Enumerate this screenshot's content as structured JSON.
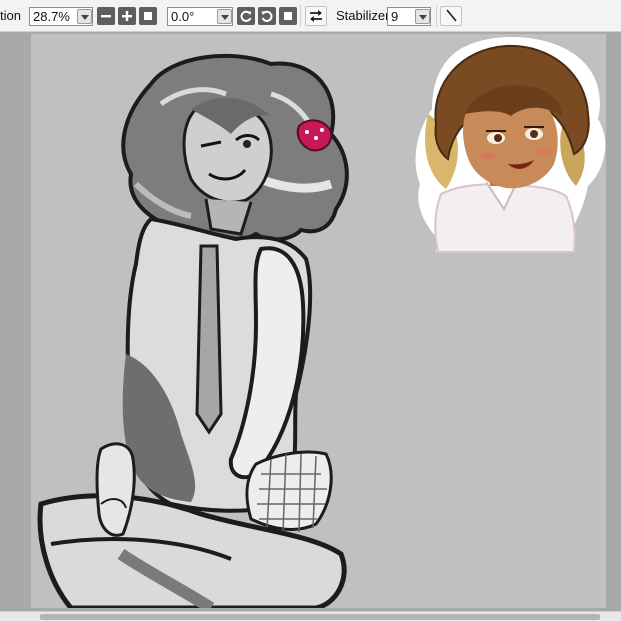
{
  "toolbar": {
    "rotation_label_fragment": "tion",
    "zoom_value": "28.7%",
    "angle_value": "0.0°",
    "stabilizer_label": "Stabilizer",
    "stabilizer_value": "9",
    "icons": {
      "zoom_out": "minus-icon",
      "zoom_in": "plus-icon",
      "zoom_reset": "square-icon",
      "rotate_left": "rotate-ccw-icon",
      "rotate_right": "rotate-cw-icon",
      "rotate_reset": "square-icon",
      "flip": "flip-horizontal-icon",
      "line": "line-tool-icon"
    }
  },
  "canvas": {
    "background_color": "#c0c0c0",
    "content": [
      "grayscale-sketch-figure",
      "color-portrait-reference"
    ]
  },
  "colors": {
    "toolbar_bg": "#f3f3f3",
    "workspace_bg": "#a9a9a9",
    "button_dark": "#5e5e5e",
    "hair_brown": "#7a4a22",
    "hair_blonde": "#d8b66a",
    "skin": "#c98a5a",
    "accent_pink": "#c8185a"
  }
}
